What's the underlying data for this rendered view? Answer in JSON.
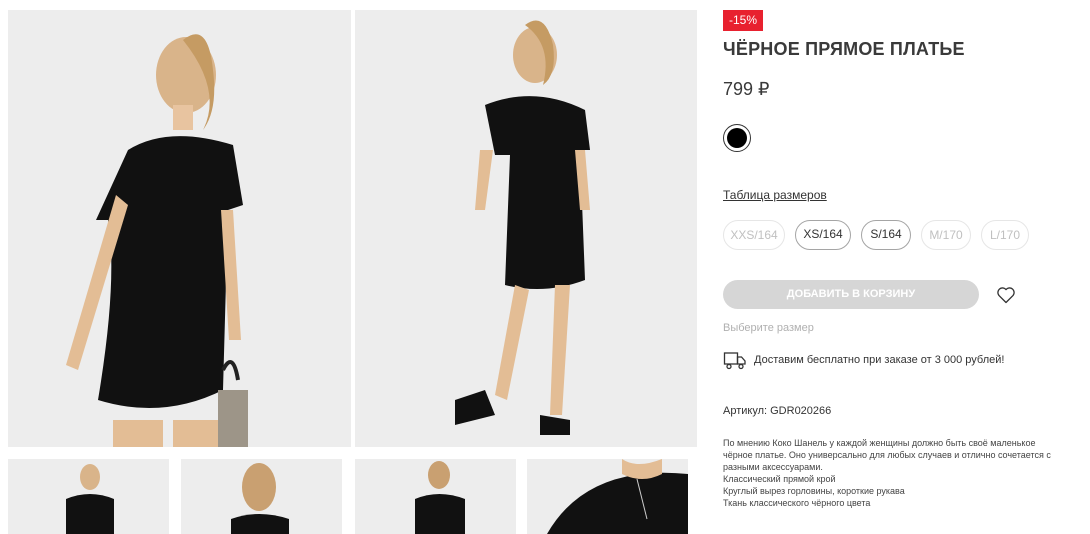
{
  "product": {
    "badge": "-15%",
    "title": "ЧЁРНОЕ ПРЯМОЕ ПЛАТЬЕ",
    "price": "799 ₽",
    "color": {
      "name": "black",
      "hex": "#000000"
    },
    "size_table_link": "Таблица размеров",
    "sizes": [
      {
        "label": "XXS/164",
        "available": false
      },
      {
        "label": "XS/164",
        "available": true
      },
      {
        "label": "S/164",
        "available": true
      },
      {
        "label": "M/170",
        "available": false
      },
      {
        "label": "L/170",
        "available": false
      }
    ],
    "add_to_cart": "ДОБАВИТЬ В КОРЗИНУ",
    "choose_size_hint": "Выберите размер",
    "delivery": "Доставим бесплатно при заказе от 3 000 рублей!",
    "sku": "Артикул: GDR020266",
    "description": [
      "По мнению Коко Шанель у каждой женщины должно быть своё маленькое",
      "чёрное платье. Оно универсально для любых случаев и отлично сочетается с",
      "разными аксессуарами.",
      "Классический прямой крой",
      "Круглый вырез горловины, короткие рукава",
      "Ткань классического чёрного цвета"
    ]
  },
  "icons": {
    "favorite": "heart-icon",
    "delivery": "truck-icon"
  },
  "colors": {
    "badge": "#e8212f",
    "button_disabled": "#d6d6d6"
  }
}
